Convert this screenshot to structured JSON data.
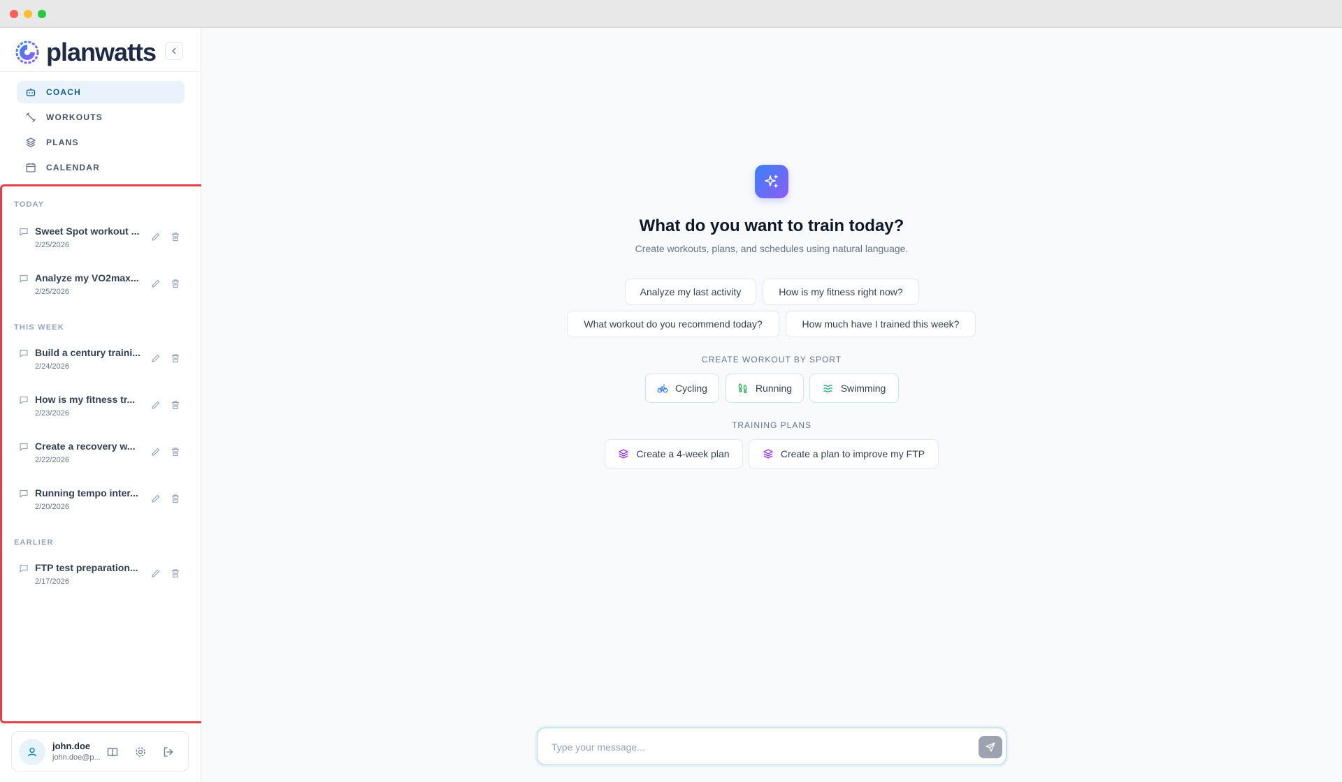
{
  "app": {
    "brand": "planwatts"
  },
  "nav": [
    {
      "label": "COACH",
      "icon": "bot-icon",
      "active": true
    },
    {
      "label": "WORKOUTS",
      "icon": "dumbbell-icon",
      "active": false
    },
    {
      "label": "PLANS",
      "icon": "layers-icon",
      "active": false
    },
    {
      "label": "CALENDAR",
      "icon": "calendar-icon",
      "active": false
    }
  ],
  "history": {
    "groups": [
      {
        "label": "TODAY",
        "items": [
          {
            "title": "Sweet Spot workout ...",
            "date": "2/25/2026"
          },
          {
            "title": "Analyze my VO2max...",
            "date": "2/25/2026"
          }
        ]
      },
      {
        "label": "THIS WEEK",
        "items": [
          {
            "title": "Build a century traini...",
            "date": "2/24/2026"
          },
          {
            "title": "How is my fitness tr...",
            "date": "2/23/2026"
          },
          {
            "title": "Create a recovery w...",
            "date": "2/22/2026"
          },
          {
            "title": "Running tempo inter...",
            "date": "2/20/2026"
          }
        ]
      },
      {
        "label": "EARLIER",
        "items": [
          {
            "title": "FTP test preparation...",
            "date": "2/17/2026"
          }
        ]
      }
    ]
  },
  "user": {
    "name": "john.doe",
    "email": "john.doe@p..."
  },
  "hero": {
    "title": "What do you want to train today?",
    "subtitle": "Create workouts, plans, and schedules using natural language."
  },
  "suggestions": [
    "Analyze my last activity",
    "How is my fitness right now?",
    "What workout do you recommend today?",
    "How much have I trained this week?"
  ],
  "sport_section": {
    "label": "CREATE WORKOUT BY SPORT",
    "items": [
      {
        "label": "Cycling",
        "icon": "bike-icon",
        "color": "#3b82f6"
      },
      {
        "label": "Running",
        "icon": "footprints-icon",
        "color": "#16a34a"
      },
      {
        "label": "Swimming",
        "icon": "waves-icon",
        "color": "#0d9488"
      }
    ]
  },
  "plans_section": {
    "label": "TRAINING PLANS",
    "items": [
      {
        "label": "Create a 4-week plan",
        "icon": "layers-icon",
        "color": "#9333ea"
      },
      {
        "label": "Create a plan to improve my FTP",
        "icon": "layers-icon",
        "color": "#9333ea"
      }
    ]
  },
  "composer": {
    "placeholder": "Type your message..."
  },
  "colors": {
    "accent": "#0e5f85",
    "highlight_border": "#e0404a"
  }
}
